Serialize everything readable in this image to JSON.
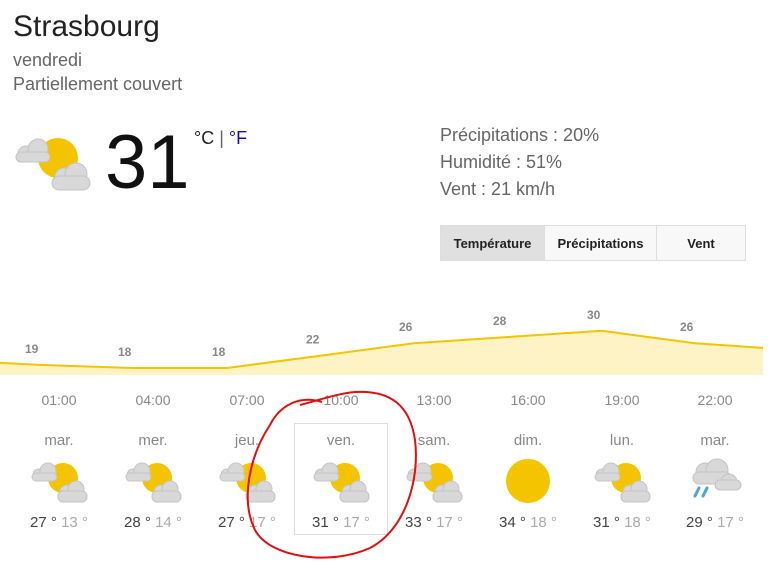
{
  "location": "Strasbourg",
  "day": "vendredi",
  "condition": "Partiellement couvert",
  "current_temp": "31",
  "units": {
    "c": "°C",
    "sep": "|",
    "f": "°F"
  },
  "stats": {
    "precipitation": "Précipitations : 20%",
    "humidity": "Humidité : 51%",
    "wind": "Vent : 21 km/h"
  },
  "tabs": [
    {
      "label": "Température",
      "active": true
    },
    {
      "label": "Précipitations",
      "active": false
    },
    {
      "label": "Vent",
      "active": false
    }
  ],
  "hourly_labels": [
    "19",
    "18",
    "18",
    "22",
    "26",
    "28",
    "30",
    "26"
  ],
  "hours": [
    "01:00",
    "04:00",
    "07:00",
    "10:00",
    "13:00",
    "16:00",
    "19:00",
    "22:00"
  ],
  "forecast": [
    {
      "day": "mar.",
      "icon": "partly-cloudy-icon",
      "hi": "27 °",
      "lo": "13 °"
    },
    {
      "day": "mer.",
      "icon": "partly-cloudy-icon",
      "hi": "28 °",
      "lo": "14 °"
    },
    {
      "day": "jeu.",
      "icon": "partly-cloudy-icon",
      "hi": "27 °",
      "lo": "17 °"
    },
    {
      "day": "ven.",
      "icon": "partly-cloudy-icon",
      "hi": "31 °",
      "lo": "17 °"
    },
    {
      "day": "sam.",
      "icon": "partly-cloudy-icon",
      "hi": "33 °",
      "lo": "17 °"
    },
    {
      "day": "dim.",
      "icon": "sunny-icon",
      "hi": "34 °",
      "lo": "18 °"
    },
    {
      "day": "lun.",
      "icon": "partly-cloudy-icon",
      "hi": "31 °",
      "lo": "18 °"
    },
    {
      "day": "mar.",
      "icon": "rain-icon",
      "hi": "29 °",
      "lo": "17 °"
    }
  ],
  "chart_data": {
    "type": "area",
    "x": [
      "01:00",
      "04:00",
      "07:00",
      "10:00",
      "13:00",
      "16:00",
      "19:00",
      "22:00"
    ],
    "values": [
      19,
      18,
      18,
      22,
      26,
      28,
      30,
      26
    ]
  },
  "colors": {
    "line": "#f5c400",
    "fill": "#fdf3c4",
    "sun": "#f5c400",
    "cloud": "#d8d8d8",
    "rain": "#4aa3df",
    "annotation": "#e01010"
  }
}
